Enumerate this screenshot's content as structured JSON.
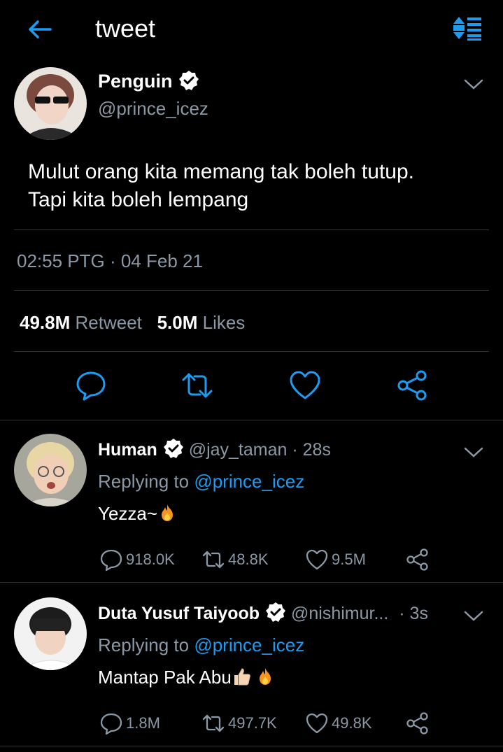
{
  "header": {
    "title": "tweet",
    "back_icon": "back-arrow-icon",
    "sort_icon": "sort-icon"
  },
  "main_tweet": {
    "name": "Penguin",
    "handle": "@prince_icez",
    "text_line1": "Mulut orang kita memang tak boleh tutup.",
    "text_line2": "Tapi kita boleh lempang",
    "time": "02:55 PTG · 04 Feb 21",
    "retweet_count": "49.8M",
    "retweet_label": "Retweet",
    "like_count": "5.0M",
    "like_label": "Likes"
  },
  "replies": [
    {
      "name": "Human",
      "handle": "@jay_taman",
      "time": "· 28s",
      "replying_prefix": "Replying to ",
      "replying_to": "@prince_icez",
      "text": "Yezza~",
      "replies": "918.0K",
      "retweets": "48.8K",
      "likes": "9.5M"
    },
    {
      "name": "Duta Yusuf Taiyoob",
      "handle": "@nishimur...",
      "time": "· 3s",
      "replying_prefix": "Replying to ",
      "replying_to": "@prince_icez",
      "text": "Mantap Pak Abu",
      "replies": "1.8M",
      "retweets": "497.7K",
      "likes": "49.8K"
    }
  ],
  "colors": {
    "background": "#000000",
    "accent": "#1d9bf0",
    "muted": "#8b98a5",
    "divider": "#2f3336"
  }
}
